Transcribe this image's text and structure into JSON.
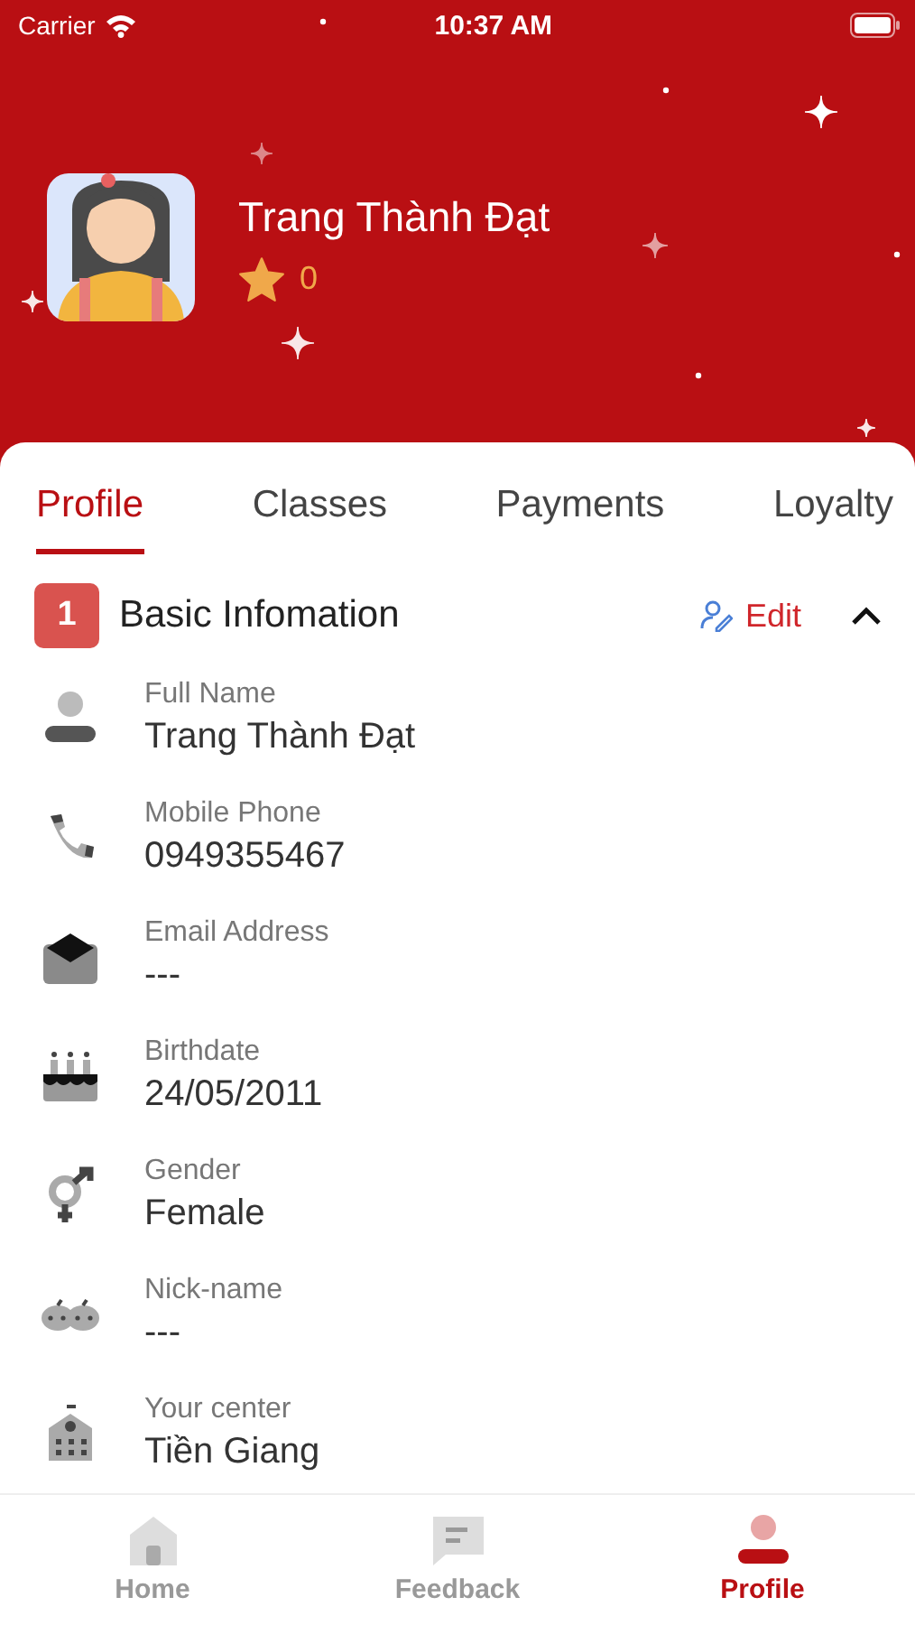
{
  "status_bar": {
    "carrier": "Carrier",
    "time": "10:37 AM"
  },
  "header": {
    "name": "Trang Thành Đạt",
    "points": "0"
  },
  "tabs": [
    {
      "label": "Profile",
      "selected": true
    },
    {
      "label": "Classes",
      "selected": false
    },
    {
      "label": "Payments",
      "selected": false
    },
    {
      "label": "Loyalty",
      "selected": false
    }
  ],
  "section": {
    "number": "1",
    "title": "Basic Infomation",
    "edit": "Edit",
    "expanded": true,
    "fields": [
      {
        "kind": "person",
        "label": "Full Name",
        "value": "Trang Thành Đạt"
      },
      {
        "kind": "phone",
        "label": "Mobile Phone",
        "value": "0949355467"
      },
      {
        "kind": "mail",
        "label": "Email Address",
        "value": "---"
      },
      {
        "kind": "cake",
        "label": "Birthdate",
        "value": "24/05/2011"
      },
      {
        "kind": "gender",
        "label": "Gender",
        "value": "Female"
      },
      {
        "kind": "mask",
        "label": "Nick-name",
        "value": "---"
      },
      {
        "kind": "building",
        "label": "Your center",
        "value": "Tiền Giang"
      }
    ]
  },
  "bottom_nav": [
    {
      "kind": "home",
      "label": "Home",
      "selected": false
    },
    {
      "kind": "feedback",
      "label": "Feedback",
      "selected": false
    },
    {
      "kind": "profile",
      "label": "Profile",
      "selected": true
    }
  ]
}
